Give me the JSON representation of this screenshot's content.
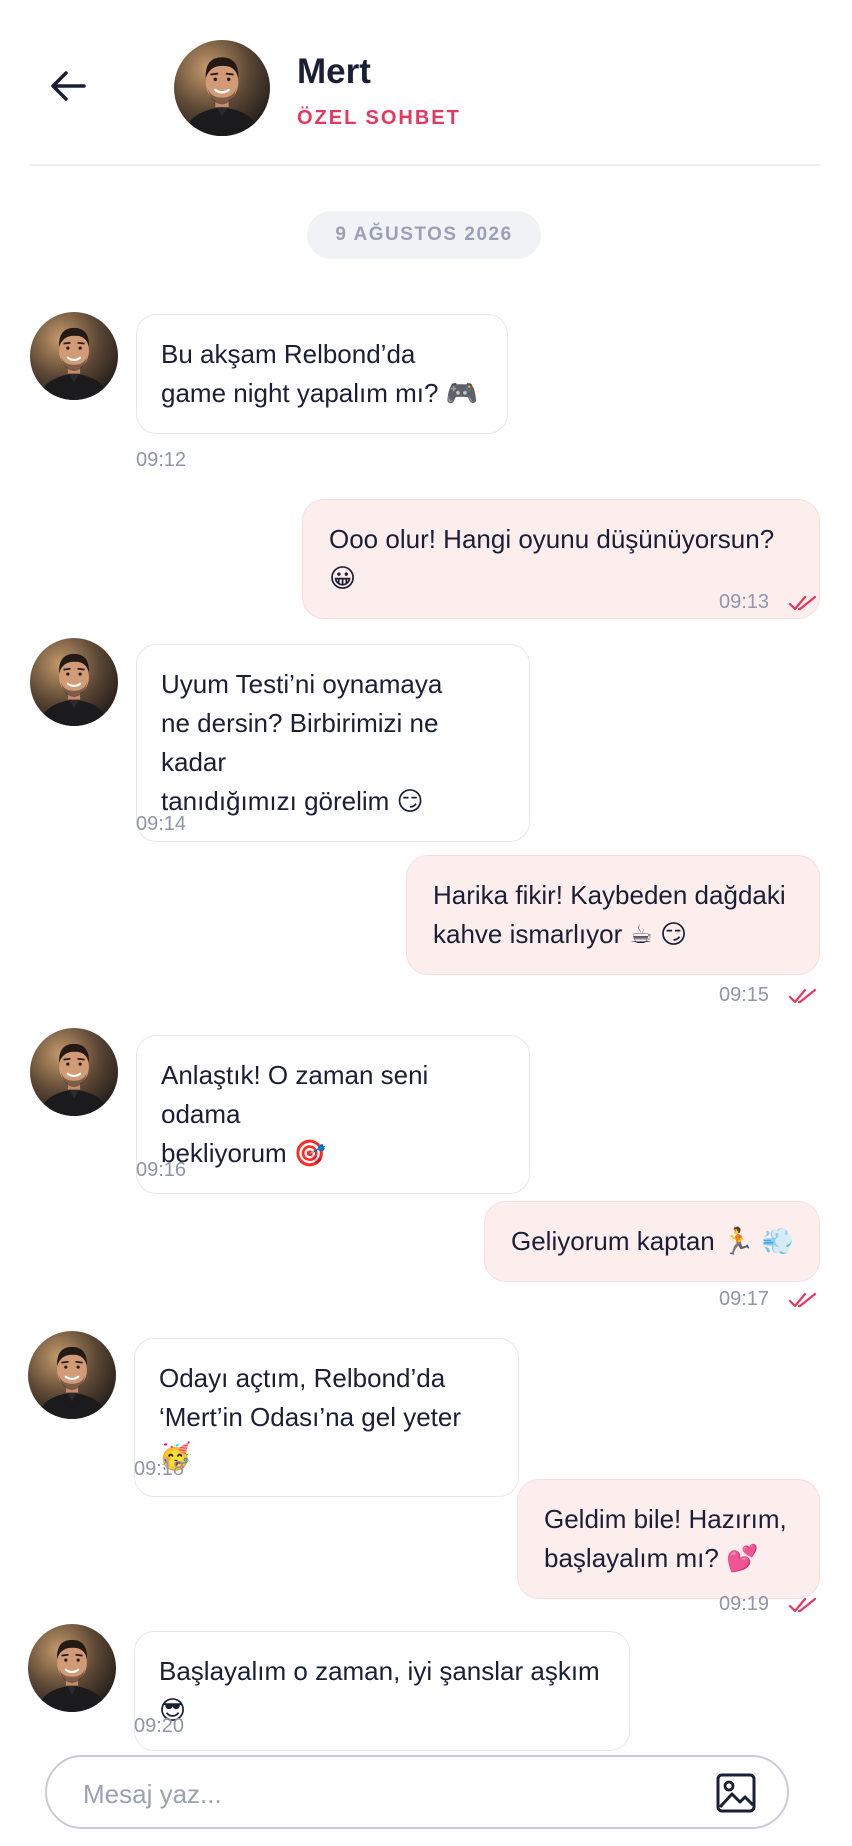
{
  "header": {
    "contact_name": "Mert",
    "subtitle": "ÖZEL SOHBET"
  },
  "date_separator": "9 AĞUSTOS 2026",
  "messages": [
    {
      "direction": "incoming",
      "text": "Bu akşam Relbond’da\ngame night yapalım mı? 🎮",
      "time": "09:12"
    },
    {
      "direction": "outgoing",
      "text": "Ooo olur! Hangi oyunu düşünüyorsun? 😀",
      "time": "09:13",
      "read": true
    },
    {
      "direction": "incoming",
      "text": "Uyum Testi’ni oynamaya\nne dersin? Birbirimizi ne kadar\ntanıdığımızı görelim 😏",
      "time": "09:14"
    },
    {
      "direction": "outgoing",
      "text": "Harika fikir! Kaybeden dağdaki\nkahve ismarlıyor ☕ 😏",
      "time": "09:15",
      "read": true
    },
    {
      "direction": "incoming",
      "text": "Anlaştık! O zaman seni odama\nbekliyorum 🎯",
      "time": "09:16"
    },
    {
      "direction": "outgoing",
      "text": "Geliyorum kaptan 🏃 💨",
      "time": "09:17",
      "read": true
    },
    {
      "direction": "incoming",
      "text": "Odayı açtım, Relbond’da\n‘Mert’in Odası’na gel yeter 🥳",
      "time": "09:18"
    },
    {
      "direction": "outgoing",
      "text": "Geldim bile! Hazırım,\nbaşlayalım mı? 💕",
      "time": "09:19",
      "read": true
    },
    {
      "direction": "incoming",
      "text": "Başlayalım o zaman, iyi şanslar aşkım 😎",
      "time": "09:20"
    }
  ],
  "composer": {
    "placeholder": "Mesaj yaz..."
  },
  "colors": {
    "accent": "#e8375f",
    "outgoing_bubble": "#fdeeee",
    "incoming_bubble": "#ffffff",
    "text": "#1a1f36",
    "muted": "#8e96a8"
  },
  "icons": [
    "back-arrow-icon",
    "double-check-icon",
    "image-icon"
  ]
}
